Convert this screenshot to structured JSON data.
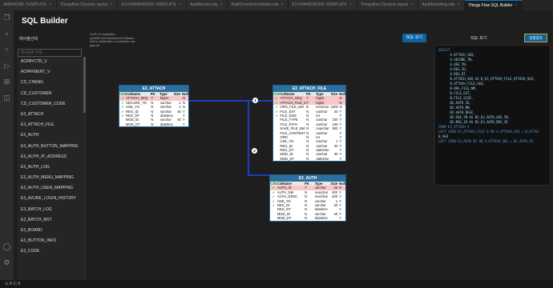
{
  "tabs": [
    {
      "label": "AMEWORK-TEMPLATE",
      "active": false
    },
    {
      "label": "Thingsflow Dynamic layout",
      "active": false
    },
    {
      "label": "E3-FRAMEWORK-TEMPLATE",
      "active": false
    },
    {
      "label": "AuditModel.sdq",
      "active": false
    },
    {
      "label": "AuditCoreActionModel.sdq",
      "active": false
    },
    {
      "label": "E3-FRAMEWORK-TEMPLATE",
      "active": false
    },
    {
      "label": "Thingsflow Dynamic layout",
      "active": false
    },
    {
      "label": "AuditModeling.sdq",
      "active": false
    },
    {
      "label": "Things Flow SQL Builder",
      "active": true
    }
  ],
  "app": {
    "title": "SQL Builder"
  },
  "left": {
    "table_label": "테이블선택",
    "search_placeholder": "테이블명 검색...",
    "tables": [
      "ACPAYCTR_V",
      "ACPAYMENT_V",
      "CD_CHENG",
      "CD_CUSTOMER",
      "CD_CUSTOMER_CODE",
      "E3_ATTACH",
      "E3_ATTACH_FILE",
      "E3_AUTH",
      "E3_AUTH_BUTTON_MAPPING",
      "E3_AUTH_IP_ADDRESS",
      "E3_AUTH_LOG",
      "E3_AUTH_MENU_MAPPING",
      "E3_AUTH_USER_MAPPING",
      "E3_AZURE_LOGIN_HISTORY",
      "E3_BATCH_LOG",
      "E3_BATCH_MST",
      "E3_BOARD",
      "E3_BUTTON_INFO",
      "E3_CODE"
    ]
  },
  "license": [
    "GoJS 3.0 evaluation",
    "(c)1998-2024 Northwoods Software",
    "Not for distribution or production use",
    "gojs.net"
  ],
  "buttons": {
    "view_sql": "SQL 보기",
    "run": "실행결과"
  },
  "sql": {
    "label": "SQL 보기",
    "lines": [
      "SELECT",
      "      A.ATTACH_SEQ,",
      "      A.SECURE_YN,",
      "      A.USE_YN,",
      "      A.REG_ID,",
      "      A.REG_DT,",
      "      B.ATTACH_SEQ AS B_E3_ATTACH_FILE_ATTACH_SEQ,",
      "      B.ATTACH_FILE_SEQ,",
      "      B.ORG_FILE_NM,",
      "      B.FILE_EXT,",
      "      B.FILE_SIZE,",
      "      B2.AUTH_ID,",
      "      B2.AUTH_NM,",
      "      B2.AUTH_DESC,",
      "      B2.USE_YN AS B2_E3_AUTH_USE_YN,",
      "      B2.REG_ID AS B2_E3_AUTH_REG_ID",
      "FROM E3_ATTACH A",
      "LEFT JOIN E3_ATTACH_FILE B ON A.ATTACH_SEQ = B.ATTAC",
      "H_SEQ",
      "LEFT JOIN E3_AUTH B2 ON A.ATTACH_SEQ = B2.AUTH_ID"
    ]
  },
  "headers": {
    "chk": "Chk",
    "col": "ColName",
    "pk": "PK",
    "type": "Type",
    "size": "Size",
    "null": "Null"
  },
  "entities": [
    {
      "title": "E3_ATTACH",
      "rows": [
        {
          "chk": "✓",
          "col": "ATTACH_SEQ",
          "pk": "Y",
          "type": "bigint",
          "size": "",
          "null": "N",
          "sel": true
        },
        {
          "chk": "✓",
          "col": "SECURE_YN",
          "pk": "N",
          "type": "varchar",
          "size": "1",
          "null": "N"
        },
        {
          "chk": "✓",
          "col": "USE_YN",
          "pk": "N",
          "type": "varchar",
          "size": "1",
          "null": "N"
        },
        {
          "chk": "✓",
          "col": "REG_ID",
          "pk": "N",
          "type": "varchar",
          "size": "40",
          "null": "Y"
        },
        {
          "chk": "✓",
          "col": "REG_DT",
          "pk": "N",
          "type": "datetime",
          "size": "",
          "null": "Y"
        },
        {
          "chk": "",
          "col": "MOD_ID",
          "pk": "N",
          "type": "varchar",
          "size": "40",
          "null": "Y"
        },
        {
          "chk": "",
          "col": "MOD_DT",
          "pk": "N",
          "type": "datetime",
          "size": "",
          "null": "Y"
        }
      ]
    },
    {
      "title": "E3_ATTACH_FILE",
      "rows": [
        {
          "chk": "✓",
          "col": "ATTACH_SEQ",
          "pk": "Y",
          "type": "bigint",
          "size": "",
          "null": "N",
          "sel": true
        },
        {
          "chk": "✓",
          "col": "ATTACH_FILE_SEQ",
          "pk": "Y",
          "type": "bigint",
          "size": "",
          "null": "N",
          "sel": true
        },
        {
          "chk": "✓",
          "col": "ORG_FILE_NM",
          "pk": "N",
          "type": "nvarchar",
          "size": "1000",
          "null": "N"
        },
        {
          "chk": "✓",
          "col": "FILE_EXT",
          "pk": "N",
          "type": "varchar",
          "size": "40",
          "null": "Y"
        },
        {
          "chk": "✓",
          "col": "FILE_SIZE",
          "pk": "N",
          "type": "int",
          "size": "",
          "null": "Y"
        },
        {
          "chk": "",
          "col": "FILE_TYPE",
          "pk": "N",
          "type": "varchar",
          "size": "100",
          "null": "Y"
        },
        {
          "chk": "",
          "col": "FILE_PATH",
          "pk": "N",
          "type": "varchar",
          "size": "100",
          "null": "Y"
        },
        {
          "chk": "",
          "col": "SAVE_FILE_NM",
          "pk": "N",
          "type": "nvarchar",
          "size": "800",
          "null": "Y"
        },
        {
          "chk": "",
          "col": "FILE_CONTENT",
          "pk": "N",
          "type": "varchar",
          "size": "",
          "null": "Y"
        },
        {
          "chk": "",
          "col": "ORD",
          "pk": "N",
          "type": "int",
          "size": "",
          "null": "Y"
        },
        {
          "chk": "",
          "col": "USE_YN",
          "pk": "N",
          "type": "varchar",
          "size": "1",
          "null": "Y"
        },
        {
          "chk": "",
          "col": "REG_ID",
          "pk": "N",
          "type": "varchar",
          "size": "40",
          "null": "Y"
        },
        {
          "chk": "",
          "col": "REG_DT",
          "pk": "N",
          "type": "datetime",
          "size": "",
          "null": "Y"
        },
        {
          "chk": "",
          "col": "MOD_ID",
          "pk": "N",
          "type": "varchar",
          "size": "40",
          "null": "Y"
        },
        {
          "chk": "",
          "col": "MOD_DT",
          "pk": "N",
          "type": "datetime",
          "size": "",
          "null": "Y"
        }
      ]
    },
    {
      "title": "E3_AUTH",
      "rows": [
        {
          "chk": "✓",
          "col": "AUTH_ID",
          "pk": "Y",
          "type": "varchar",
          "size": "40",
          "null": "N",
          "sel": true
        },
        {
          "chk": "✓",
          "col": "AUTH_NM",
          "pk": "N",
          "type": "nvarchar",
          "size": "400",
          "null": "Y"
        },
        {
          "chk": "✓",
          "col": "AUTH_DESC",
          "pk": "N",
          "type": "nvarchar",
          "size": "400",
          "null": "Y"
        },
        {
          "chk": "✓",
          "col": "USE_YN",
          "pk": "N",
          "type": "varchar",
          "size": "1",
          "null": "Y"
        },
        {
          "chk": "✓",
          "col": "REG_ID",
          "pk": "N",
          "type": "varchar",
          "size": "40",
          "null": "Y"
        },
        {
          "chk": "",
          "col": "REG_DT",
          "pk": "N",
          "type": "datetime",
          "size": "",
          "null": "Y"
        },
        {
          "chk": "",
          "col": "MOD_ID",
          "pk": "N",
          "type": "varchar",
          "size": "40",
          "null": "Y"
        },
        {
          "chk": "",
          "col": "MOD_DT",
          "pk": "N",
          "type": "datetime",
          "size": "",
          "null": "Y"
        }
      ]
    }
  ],
  "links": [
    {
      "label": "1"
    },
    {
      "label": "2"
    }
  ],
  "status": {
    "left": "⚠ 0  ⓧ 0"
  },
  "colors": {
    "accent": "#0e639c",
    "entity_header": "#2a6f9e",
    "link": "#1a3fb8",
    "pk_row": "#f7c7c7"
  }
}
